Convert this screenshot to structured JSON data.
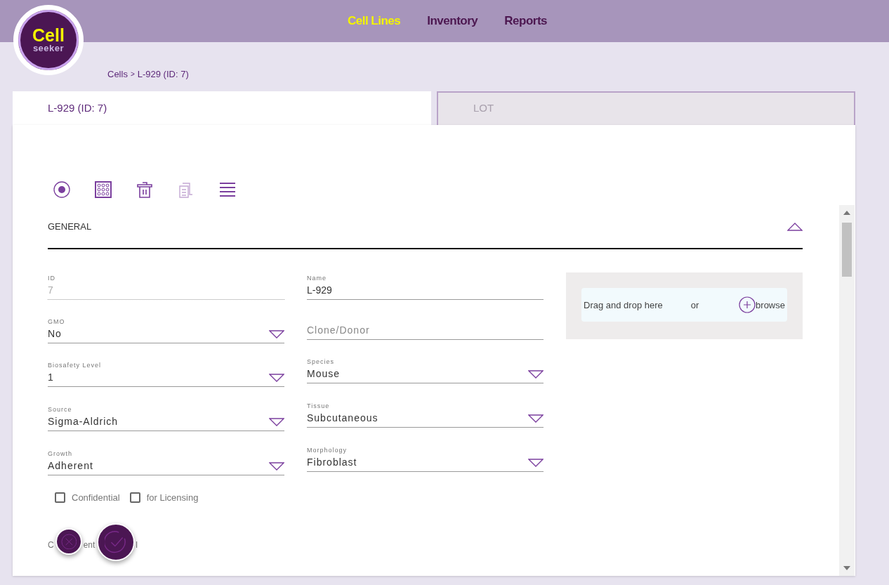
{
  "logo": {
    "main": "Cell",
    "sub": "seeker"
  },
  "nav": [
    {
      "label": "Cell Lines",
      "selected": true
    },
    {
      "label": "Inventory",
      "selected": false
    },
    {
      "label": "Reports",
      "selected": false
    }
  ],
  "breadcrumb": {
    "parent": "Cells",
    "separator": ">",
    "current": "L-929 (ID: 7)"
  },
  "tabs": [
    {
      "label": "L-929 (ID: 7)",
      "selected": true
    },
    {
      "label": "LOT",
      "selected": false
    }
  ],
  "toolbar": [
    {
      "kind": "radio",
      "disabled": false
    },
    {
      "kind": "plate",
      "disabled": false
    },
    {
      "kind": "trash",
      "disabled": false
    },
    {
      "kind": "copy",
      "disabled": true
    },
    {
      "kind": "list",
      "disabled": false
    }
  ],
  "section": {
    "title": "GENERAL",
    "expanded": true
  },
  "left_fields": [
    {
      "kind": "readonly",
      "label": "ID",
      "value": "7"
    },
    {
      "kind": "select",
      "label": "GMO",
      "value": "No"
    },
    {
      "kind": "select",
      "label": "Biosafety Level",
      "value": "1"
    },
    {
      "kind": "select",
      "label": "Source",
      "value": "Sigma-Aldrich"
    },
    {
      "kind": "select",
      "label": "Growth",
      "value": "Adherent"
    }
  ],
  "right_fields": [
    {
      "kind": "text",
      "label": "Name",
      "value": "L-929"
    },
    {
      "kind": "empty",
      "placeholder": "Clone/Donor"
    },
    {
      "kind": "select",
      "label": "Species",
      "value": "Mouse"
    },
    {
      "kind": "select",
      "label": "Tissue",
      "value": "Subcutaneous"
    },
    {
      "kind": "select",
      "label": "Morphology",
      "value": "Fibroblast"
    }
  ],
  "dropzone": {
    "text": "Drag and drop here",
    "or": "or",
    "browse": "browse"
  },
  "checkboxes": [
    {
      "label": "Confidential",
      "checked": false
    },
    {
      "label": "for Licensing",
      "checked": false
    }
  ],
  "next_field": {
    "label_fragments": [
      "C",
      "ent",
      "l"
    ]
  }
}
